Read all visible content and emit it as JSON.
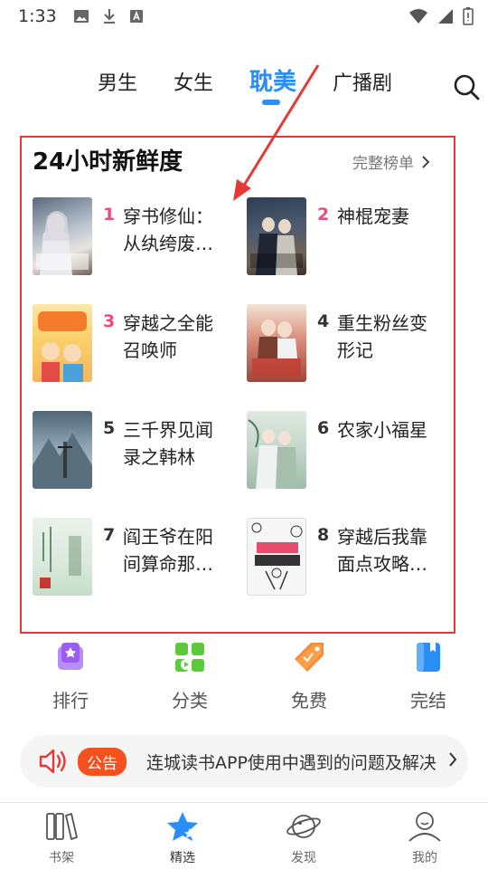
{
  "status_bar": {
    "time": "1:33"
  },
  "top_tabs": [
    {
      "label": "男生"
    },
    {
      "label": "女生"
    },
    {
      "label": "耽美"
    },
    {
      "label": "广播剧"
    }
  ],
  "ranking": {
    "title": "24小时新鲜度",
    "more_label": "完整榜单",
    "books": [
      {
        "rank": "1",
        "title": "穿书修仙：从纨绔废…"
      },
      {
        "rank": "2",
        "title": "神棍宠妻"
      },
      {
        "rank": "3",
        "title": "穿越之全能召唤师"
      },
      {
        "rank": "4",
        "title": "重生粉丝变形记"
      },
      {
        "rank": "5",
        "title": "三千界见闻录之韩林"
      },
      {
        "rank": "6",
        "title": "农家小福星"
      },
      {
        "rank": "7",
        "title": "阎王爷在阳间算命那…"
      },
      {
        "rank": "8",
        "title": "穿越后我靠面点攻略…"
      }
    ]
  },
  "quick_entries": [
    {
      "label": "排行",
      "icon": "ranking-icon"
    },
    {
      "label": "分类",
      "icon": "category-icon"
    },
    {
      "label": "免费",
      "icon": "free-tag-icon"
    },
    {
      "label": "完结",
      "icon": "finished-book-icon"
    }
  ],
  "notice": {
    "badge": "公告",
    "text": "连城读书APP使用中遇到的问题及解决"
  },
  "bottom_nav": [
    {
      "label": "书架",
      "icon": "bookshelf-icon"
    },
    {
      "label": "精选",
      "icon": "star-icon"
    },
    {
      "label": "发现",
      "icon": "planet-icon"
    },
    {
      "label": "我的",
      "icon": "user-icon"
    }
  ],
  "colors": {
    "accent": "#2a8ef7",
    "rank_hot": "#ee4a7c",
    "annotation_red": "#e53935",
    "notice_badge": "#f4511e"
  }
}
